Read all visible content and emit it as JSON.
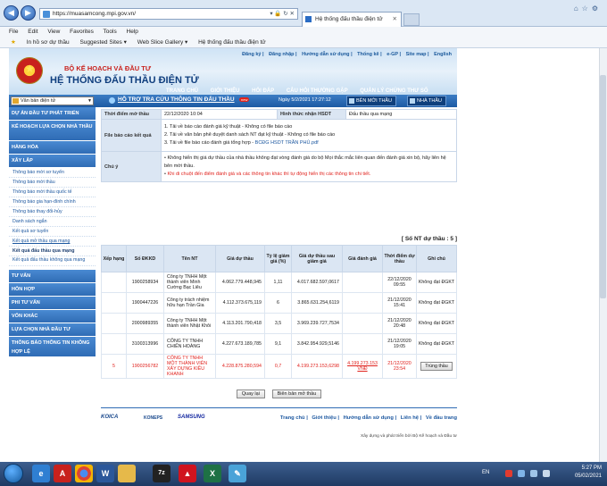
{
  "browser": {
    "url": "https://muasamcong.mpi.gov.vn/",
    "tab_title": "Hệ thống đấu thầu điện tử",
    "menu": [
      "File",
      "Edit",
      "View",
      "Favorites",
      "Tools",
      "Help"
    ],
    "favorites": [
      "In hồ sơ dự thầu",
      "Suggested Sites ▾",
      "Web Slice Gallery ▾",
      "Hệ thống đấu thầu điện tử"
    ]
  },
  "header": {
    "toplinks": [
      "Đăng ký",
      "Đăng nhập",
      "Hướng dẫn sử dụng",
      "Thống kê",
      "e-GP",
      "Site map",
      "English"
    ],
    "ministry": "BỘ KẾ HOẠCH VÀ ĐẦU TƯ",
    "system": "HỆ THỐNG ĐẤU THẦU ĐIỆN TỬ",
    "nav": [
      "TRANG CHỦ",
      "GIỚI THIỆU",
      "HỎI ĐÁP",
      "CÂU HỎI THƯỜNG GẶP",
      "QUẢN LÝ CHỨNG THƯ SỐ"
    ],
    "search_select": "Văn bản điện tử",
    "support": "HỖ TRỢ TRA CỨU THÔNG TIN ĐẤU THẦU",
    "new_badge": "new",
    "datetime": "Ngày 5/2/2021 17:27:12",
    "btn_bidder": "BÊN MỜI THẦU",
    "btn_contractor": "NHÀ THẦU"
  },
  "sidebar": {
    "sections": [
      {
        "label": "DỰ ÁN ĐẦU TƯ PHÁT TRIỂN"
      },
      {
        "label": "KẾ HOẠCH LỰA CHỌN NHÀ THẦU",
        "tall": true
      },
      {
        "label": "HÀNG HÓA"
      },
      {
        "label": "XÂY LẮP"
      }
    ],
    "sub_items": [
      "Thông báo mời sơ tuyển",
      "Thông báo mời thầu",
      "Thông báo mời thầu quốc tế",
      "Thông báo gia hạn-đính chính",
      "Thông báo thay đổi-hủy",
      "Danh sách ngắn",
      "Kết quả sơ tuyển",
      "Kết quả mở thầu qua mạng",
      "Kết quả đấu thầu qua mạng",
      "Kết quả đấu thầu không qua mạng"
    ],
    "lower_sections": [
      "TƯ VẤN",
      "HỖN HỢP",
      "PHI TƯ VẤN",
      "VỐN KHÁC",
      "LỰA CHỌN NHÀ ĐẦU TƯ",
      "THÔNG BÁO THÔNG TIN KHÔNG HỢP LỆ"
    ]
  },
  "info": {
    "open_time_label": "Thời điểm mở thầu",
    "open_time": "22/12/2020 10:04",
    "form_label": "Hình thức nhận HSDT",
    "form": "Đấu thầu qua mạng",
    "report_label": "File báo cáo kết quả",
    "report_items": [
      "1. Tải về báo cáo đánh giá kỹ thuật - Không có file báo cáo",
      "2. Tải về văn bản phê duyệt danh sách NT đạt kỹ thuật - Không có file báo cáo",
      "3. Tải về file báo cáo đánh giá tổng hợp - "
    ],
    "report_link": "BCĐG HSDT TRẦN PHÚ.pdf",
    "note_label": "Chú ý",
    "note1": "Không hiển thị giá dự thầu của nhà thầu không đạt vòng đánh giá do bộ Mọi thắc mắc liên quan đến đánh giá xin bộ, hãy liên hệ bên mời thầu.",
    "note2": "Khi di chuột đến điểm đánh giá và các thông tin khác thì tự động hiển thị các thông tin chi tiết."
  },
  "results": {
    "count_text": "[ Số NT dự thầu : 5 ]",
    "headers": [
      "Xếp hạng",
      "Số ĐKKD",
      "Tên NT",
      "Giá dự thầu",
      "Tỷ lệ giảm giá (%)",
      "Giá dự thầu sau giảm giá",
      "Giá đánh giá",
      "Thời điểm dự thầu",
      "Ghi chú"
    ],
    "rows": [
      {
        "rank": "",
        "reg": "1900258934",
        "name": "Công ty TNHH Một thành viên Minh Cường Bạc Liêu",
        "price": "4.062.779.448,945",
        "disc": "1,11",
        "after": "4.017.682.597,0617",
        "eval": "",
        "time": "22/12/2020 09:55",
        "note": "Không đạt ĐGKT"
      },
      {
        "rank": "",
        "reg": "1900447226",
        "name": "Công ty trách nhiệm hữu hạn Trần Gia",
        "price": "4.112.373.675,119",
        "disc": "6",
        "after": "3.865.631.254,6119",
        "eval": "",
        "time": "21/12/2020 15:41",
        "note": "Không đạt ĐGKT"
      },
      {
        "rank": "",
        "reg": "2000989355",
        "name": "Công ty TNHH Một thành viên Nhật Khôi",
        "price": "4.113.201.790,418",
        "disc": "3,5",
        "after": "3.969.239.727,7534",
        "eval": "",
        "time": "21/12/2020 20:48",
        "note": "Không đạt ĐGKT"
      },
      {
        "rank": "",
        "reg": "3100313996",
        "name": "CÔNG TY TNHH CHIẾN HOÀNG",
        "price": "4.227.673.189,785",
        "disc": "9,1",
        "after": "3.842.954.929,5146",
        "eval": "",
        "time": "21/12/2020 19:05",
        "note": "Không đạt ĐGKT"
      },
      {
        "rank": "5",
        "reg": "1900256782",
        "name": "CÔNG TY TNHH MỘT THÀNH VIÊN XÂY DỰNG KIỀU KHANH",
        "price": "4.228.875.280,594",
        "disc": "0,7",
        "after": "4.199.273.153,6298",
        "eval": "4.199.273.153 VNĐ",
        "time": "21/12/2020 23:54",
        "note": "Trúng thầu",
        "winner": true
      }
    ]
  },
  "buttons": {
    "back": "Quay lại",
    "minutes": "Biên bản mở thầu"
  },
  "footer": {
    "links": [
      "Trang chủ",
      "Giới thiệu",
      "Hướng dẫn sử dụng",
      "Liên hệ",
      "Về đầu trang"
    ],
    "copyright": "Xây dựng và phát triển bởi Bộ Kế hoạch và Đầu tư",
    "logos": [
      "KOICA",
      "KONEPS",
      "SAMSUNG"
    ]
  },
  "taskbar": {
    "lang": "EN",
    "time": "5:27 PM",
    "date": "05/02/2021",
    "apps": [
      "IE",
      "PDF",
      "Chrome",
      "Word",
      "Folder",
      "7z",
      "Acrobat",
      "Excel",
      "Paint"
    ]
  }
}
